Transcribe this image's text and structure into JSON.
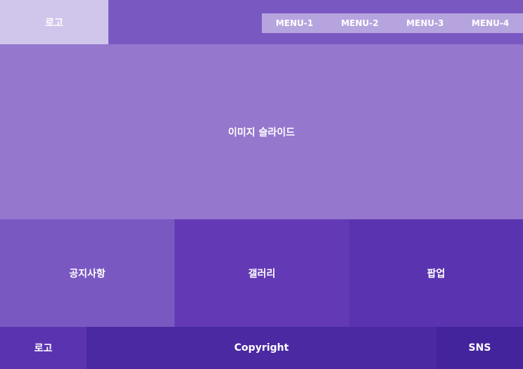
{
  "colors": {
    "header_bg": "#7a58c2",
    "header_logo_bg": "#d0c5ea",
    "nav_bg": "#b6a4de",
    "slider_bg": "#9577ce",
    "notice_bg": "#7a58c2",
    "gallery_bg": "#6439b5",
    "popup_bg": "#5a34b0",
    "footer_logo_bg": "#5a34b0",
    "footer_copyright_bg": "#4a29a3",
    "footer_sns_bg": "#44249c",
    "text": "#ffffff"
  },
  "header": {
    "logo": "로고",
    "menu": [
      {
        "label": "MENU-1"
      },
      {
        "label": "MENU-2"
      },
      {
        "label": "MENU-3"
      },
      {
        "label": "MENU-4"
      }
    ]
  },
  "slider": {
    "label": "이미지 슬라이드"
  },
  "contents": {
    "notice": "공지사항",
    "gallery": "갤러리",
    "popup": "팝업"
  },
  "footer": {
    "logo": "로고",
    "copyright": "Copyright",
    "sns": "SNS"
  }
}
